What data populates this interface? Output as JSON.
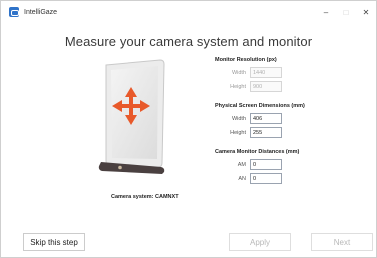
{
  "window": {
    "app_title": "IntelliGaze",
    "minimize_icon": "minimize-icon",
    "maximize_icon": "maximize-icon",
    "close_icon": "close-icon",
    "minimize_glyph": "–",
    "maximize_glyph": "□",
    "close_glyph": "✕"
  },
  "page": {
    "title": "Measure your camera system and monitor",
    "camera_label": "Camera system: CAMNXT"
  },
  "monitor_resolution": {
    "title": "Monitor Resolution (px)",
    "width_label": "Width",
    "width_value": "1440",
    "height_label": "Height",
    "height_value": "900"
  },
  "physical_dimensions": {
    "title": "Physical Screen Dimensions (mm)",
    "width_label": "Width",
    "width_value": "406",
    "height_label": "Height",
    "height_value": "255"
  },
  "camera_distances": {
    "title": "Camera Monitor Distances (mm)",
    "am_label": "AM",
    "am_value": "0",
    "an_label": "AN",
    "an_value": "0"
  },
  "buttons": {
    "skip": "Skip this step",
    "apply": "Apply",
    "next": "Next"
  },
  "colors": {
    "accent": "#2f73c9",
    "arrows": "#e8592a",
    "camera_bar": "#4a4040"
  }
}
